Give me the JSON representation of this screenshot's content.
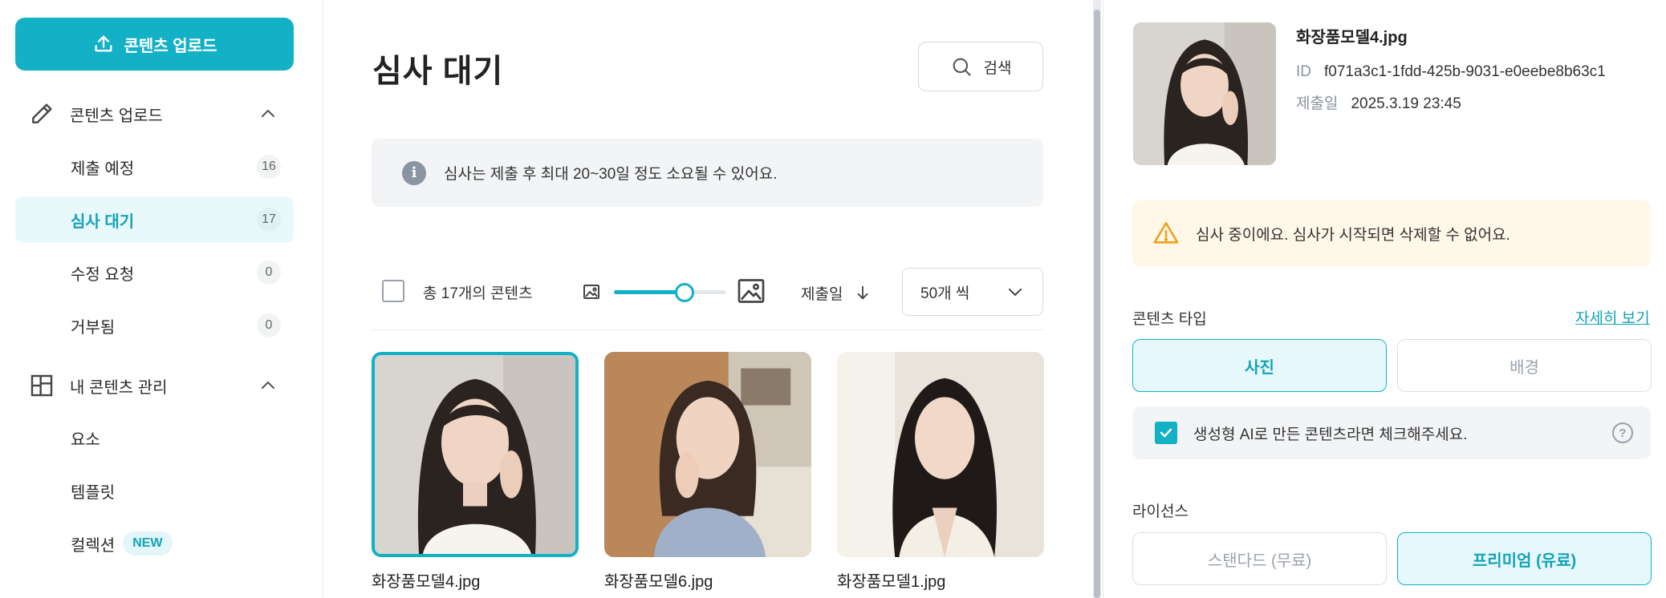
{
  "sidebar": {
    "upload_button": "콘텐츠 업로드",
    "group_upload": {
      "label": "콘텐츠 업로드"
    },
    "upload_items": [
      {
        "label": "제출 예정",
        "count": "16"
      },
      {
        "label": "심사 대기",
        "count": "17",
        "active": true
      },
      {
        "label": "수정 요청",
        "count": "0"
      },
      {
        "label": "거부됨",
        "count": "0"
      }
    ],
    "group_manage": {
      "label": "내 콘텐츠 관리"
    },
    "manage_items": [
      {
        "label": "요소"
      },
      {
        "label": "템플릿"
      },
      {
        "label": "컬렉션",
        "badge": "NEW"
      }
    ]
  },
  "main": {
    "title": "심사 대기",
    "search_label": "검색",
    "info_text": "심사는 제출 후 최대 20~30일 정도 소요될 수 있어요.",
    "total_label": "총 17개의 콘텐츠",
    "thumbnail_size_percent": 63,
    "sort_label": "제출일",
    "per_page": "50개 씩",
    "cards": [
      {
        "filename": "화장품모델4.jpg",
        "selected": true
      },
      {
        "filename": "화장품모델6.jpg",
        "selected": false
      },
      {
        "filename": "화장품모델1.jpg",
        "selected": false
      }
    ]
  },
  "panel": {
    "filename": "화장품모델4.jpg",
    "id_label": "ID",
    "id_value": "f071a3c1-1fdd-425b-9031-e0eebe8b63c1",
    "date_label": "제출일",
    "date_value": "2025.3.19 23:45",
    "warning": "심사 중이에요. 심사가 시작되면 삭제할 수 없어요.",
    "content_type_label": "콘텐츠 타입",
    "details_link": "자세히 보기",
    "type_photo": "사진",
    "type_background": "배경",
    "ai_checkbox_label": "생성형 AI로 만든 콘텐츠라면 체크해주세요.",
    "ai_checked": true,
    "license_label": "라이선스",
    "license_standard": "스탠다드 (무료)",
    "license_premium": "프리미엄 (유료)"
  },
  "colors": {
    "accent": "#13b1c6",
    "warning_bg": "#fff7e8",
    "warning_icon": "#f0a020"
  }
}
